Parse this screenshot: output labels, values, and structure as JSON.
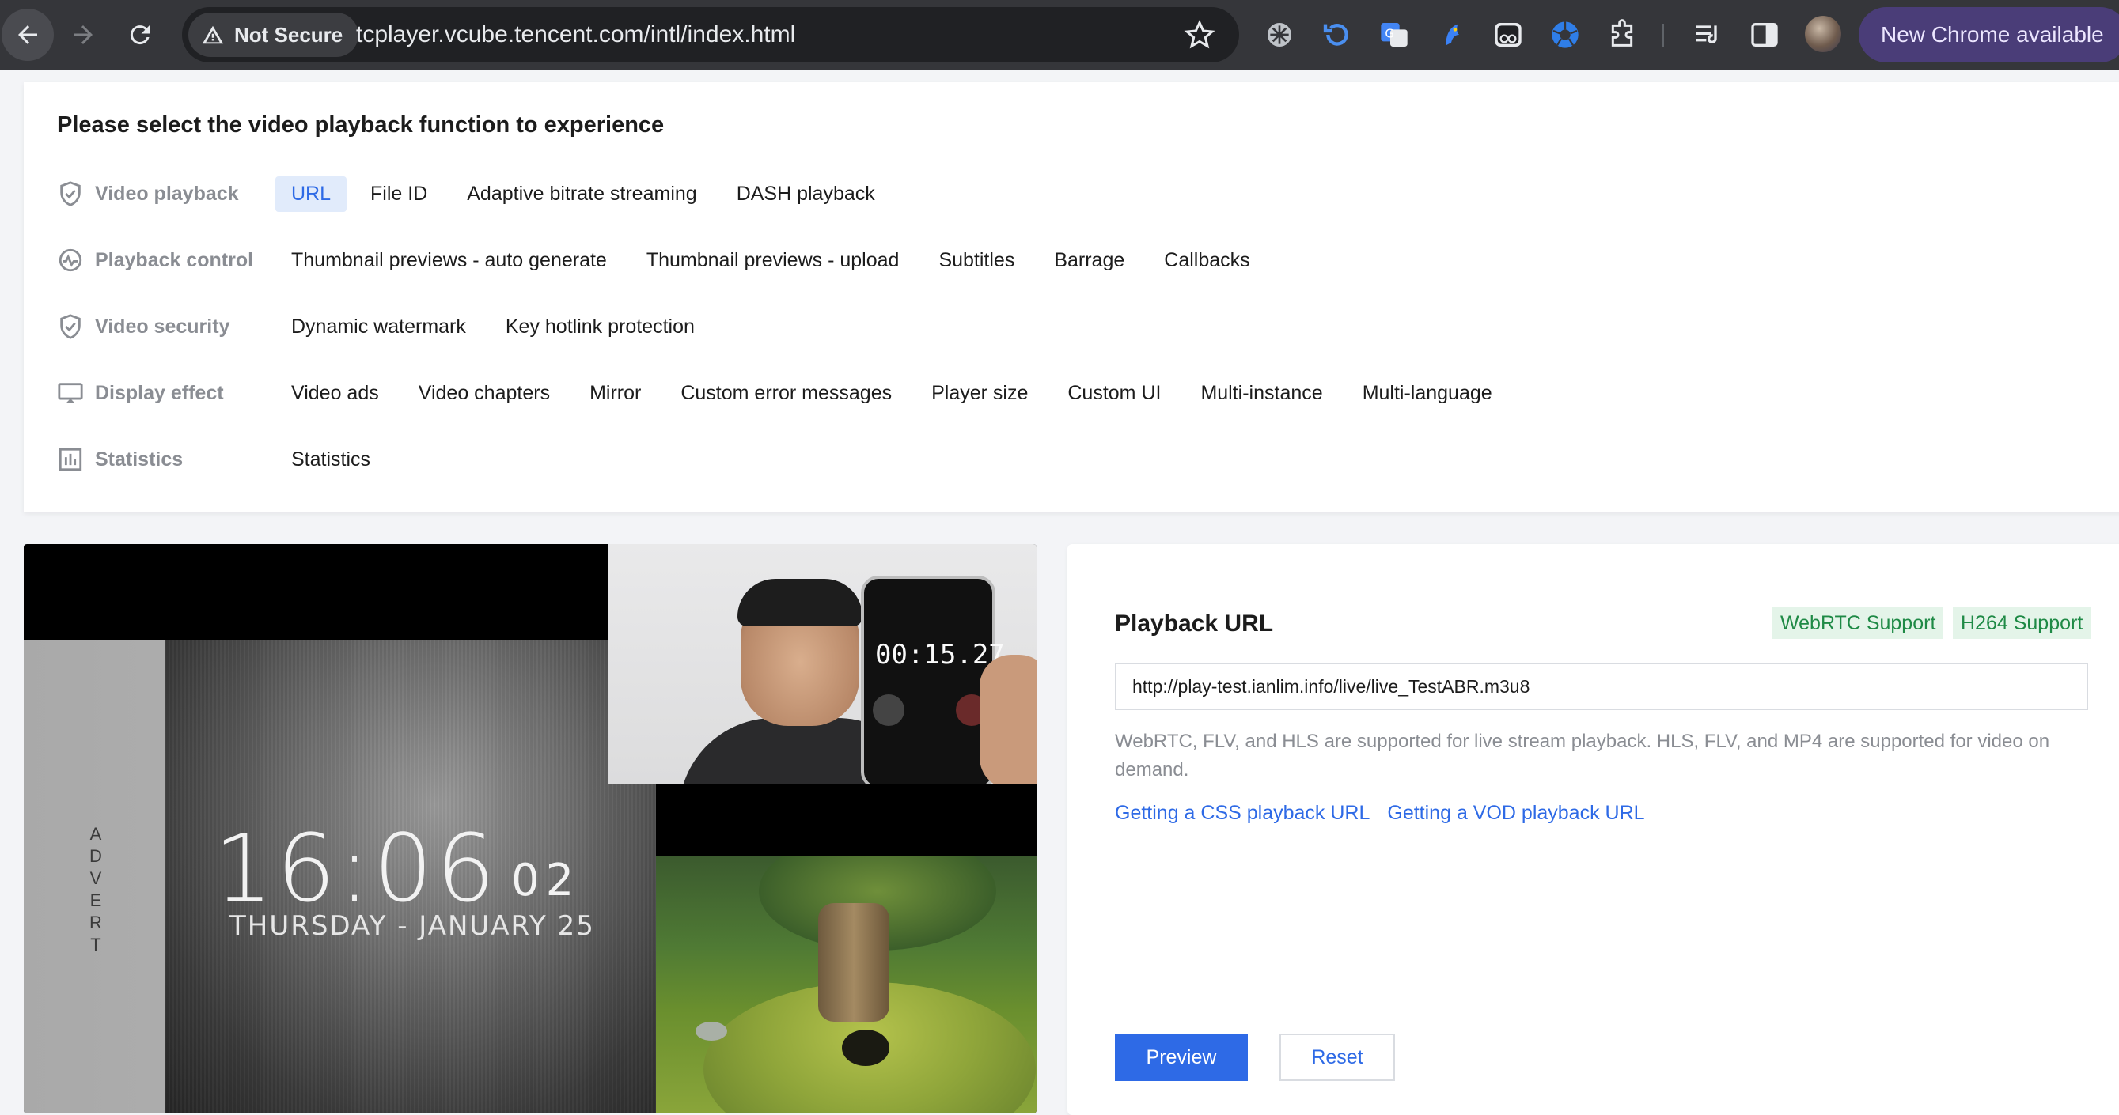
{
  "browser": {
    "security_chip": "Not Secure",
    "url": "tcplayer.vcube.tencent.com/intl/index.html",
    "update_button": "New Chrome available"
  },
  "function_panel": {
    "title": "Please select the video playback function to experience",
    "rows": [
      {
        "label": "Video playback",
        "icon": "shield-check-icon",
        "options": [
          "URL",
          "File ID",
          "Adaptive bitrate streaming",
          "DASH playback"
        ],
        "active": "URL"
      },
      {
        "label": "Playback control",
        "icon": "playback-control-icon",
        "options": [
          "Thumbnail previews - auto generate",
          "Thumbnail previews - upload",
          "Subtitles",
          "Barrage",
          "Callbacks"
        ]
      },
      {
        "label": "Video security",
        "icon": "shield-check-icon",
        "options": [
          "Dynamic watermark",
          "Key hotlink protection"
        ]
      },
      {
        "label": "Display effect",
        "icon": "monitor-icon",
        "options": [
          "Video ads",
          "Video chapters",
          "Mirror",
          "Custom error messages",
          "Player size",
          "Custom UI",
          "Multi-instance",
          "Multi-language"
        ]
      },
      {
        "label": "Statistics",
        "icon": "bar-chart-icon",
        "options": [
          "Statistics"
        ]
      }
    ]
  },
  "video": {
    "advert_text": "ADVERT",
    "clock_time": "16:06",
    "clock_seconds": "02",
    "clock_date": "THURSDAY - JANUARY 25",
    "stopwatch": "00:15.27"
  },
  "playback_panel": {
    "title": "Playback URL",
    "tags": [
      "WebRTC Support",
      "H264 Support"
    ],
    "url_value": "http://play-test.ianlim.info/live/live_TestABR.m3u8",
    "help_text": "WebRTC, FLV, and HLS are supported for live stream playback. HLS, FLV, and MP4 are supported for video on demand.",
    "links": [
      "Getting a CSS playback URL",
      "Getting a VOD playback URL"
    ],
    "preview_label": "Preview",
    "reset_label": "Reset"
  },
  "colors": {
    "accent": "#2e6ae6",
    "tag_bg": "#e4f4e9",
    "tag_text": "#1f8a46",
    "toolbar_bg": "#35363a"
  }
}
